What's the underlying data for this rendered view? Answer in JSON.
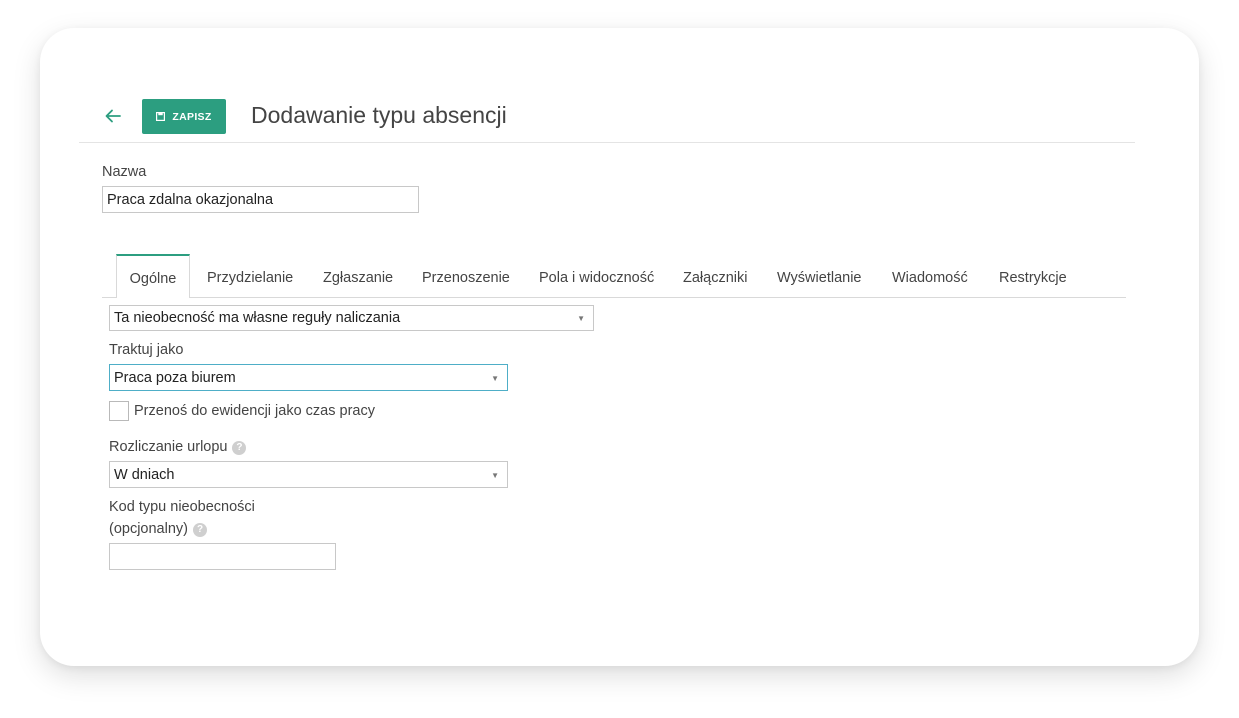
{
  "header": {
    "save_label": "ZAPISZ",
    "title": "Dodawanie typu absencji"
  },
  "name_field": {
    "label": "Nazwa",
    "value": "Praca zdalna okazjonalna"
  },
  "tabs": [
    {
      "label": "Ogólne",
      "active": true
    },
    {
      "label": "Przydzielanie"
    },
    {
      "label": "Zgłaszanie"
    },
    {
      "label": "Przenoszenie"
    },
    {
      "label": "Pola i widoczność"
    },
    {
      "label": "Załączniki"
    },
    {
      "label": "Wyświetlanie"
    },
    {
      "label": "Wiadomość"
    },
    {
      "label": "Restrykcje"
    }
  ],
  "general": {
    "rules_select": "Ta nieobecność ma własne reguły naliczania",
    "treat_as": {
      "label": "Traktuj jako",
      "value": "Praca poza biurem"
    },
    "transfer_checkbox": {
      "label": "Przenoś do ewidencji jako czas pracy",
      "checked": false
    },
    "leave_settlement": {
      "label": "Rozliczanie urlopu",
      "value": "W dniach",
      "help_icon": "?"
    },
    "absence_code": {
      "label_line1": "Kod typu nieobecności",
      "label_line2": "(opcjonalny)",
      "value": "",
      "help_icon": "?"
    }
  },
  "colors": {
    "accent": "#2c9e80",
    "focus_border": "#4eaec7"
  }
}
